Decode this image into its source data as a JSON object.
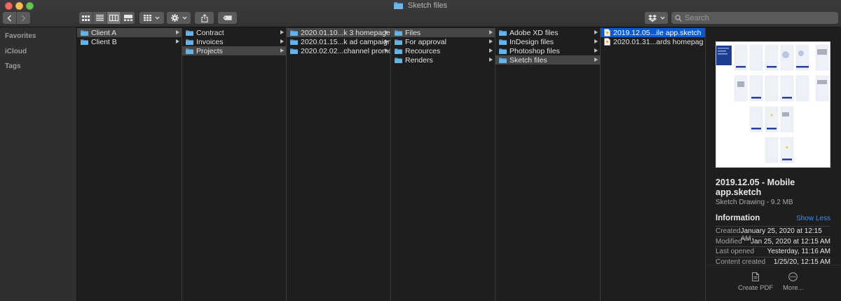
{
  "window": {
    "title": "Sketch files"
  },
  "search": {
    "placeholder": "Search"
  },
  "sidebar": {
    "sections": [
      "Favorites",
      "iCloud",
      "Tags"
    ]
  },
  "columns": [
    {
      "items": [
        {
          "label": "Client A",
          "type": "folder",
          "state": "path",
          "arrow": true
        },
        {
          "label": "Client B",
          "type": "folder",
          "state": "",
          "arrow": true
        }
      ]
    },
    {
      "items": [
        {
          "label": "Contract",
          "type": "folder",
          "state": "",
          "arrow": true
        },
        {
          "label": "Invoices",
          "type": "folder",
          "state": "",
          "arrow": true
        },
        {
          "label": "Projects",
          "type": "folder",
          "state": "path",
          "arrow": true
        }
      ]
    },
    {
      "items": [
        {
          "label": "2020.01.10...k  3 homepage",
          "type": "folder",
          "state": "path",
          "arrow": true
        },
        {
          "label": "2020.01.15...k ad campaign",
          "type": "folder",
          "state": "",
          "arrow": true
        },
        {
          "label": "2020.02.02...channel promo",
          "type": "folder",
          "state": "",
          "arrow": true
        }
      ]
    },
    {
      "items": [
        {
          "label": "Files",
          "type": "folder",
          "state": "path",
          "arrow": true
        },
        {
          "label": "For approval",
          "type": "folder",
          "state": "",
          "arrow": true
        },
        {
          "label": "Recources",
          "type": "folder",
          "state": "",
          "arrow": true
        },
        {
          "label": "Renders",
          "type": "folder",
          "state": "",
          "arrow": true
        }
      ]
    },
    {
      "items": [
        {
          "label": "Adobe XD files",
          "type": "folder",
          "state": "",
          "arrow": true
        },
        {
          "label": "InDesign files",
          "type": "folder",
          "state": "",
          "arrow": true
        },
        {
          "label": "Photoshop files",
          "type": "folder",
          "state": "",
          "arrow": true
        },
        {
          "label": "Sketch files",
          "type": "folder",
          "state": "path",
          "arrow": true
        }
      ]
    },
    {
      "items": [
        {
          "label": "2019.12.05...ile app.sketch",
          "type": "file",
          "state": "selected",
          "arrow": false
        },
        {
          "label": "2020.01.31...ards homepag",
          "type": "file",
          "state": "",
          "arrow": false
        }
      ]
    }
  ],
  "preview": {
    "name": "2019.12.05 - Mobile app.sketch",
    "kind": "Sketch Drawing - 9.2 MB",
    "info_title": "Information",
    "show_less": "Show Less",
    "info": [
      {
        "key": "Created",
        "value": "January 25, 2020 at 12:15 AM"
      },
      {
        "key": "Modified",
        "value": "Jan 25, 2020 at 12:15 AM"
      },
      {
        "key": "Last opened",
        "value": "Yesterday, 11:16 AM"
      },
      {
        "key": "Content created",
        "value": "1/25/20, 12:15 AM"
      }
    ],
    "actions": [
      {
        "label": "Create PDF",
        "icon": "pdf-document-icon"
      },
      {
        "label": "More...",
        "icon": "more-ellipsis-icon"
      }
    ]
  },
  "colors": {
    "selection": "#0a5bd3",
    "path_highlight": "#464646",
    "folder_blue": "#5aa8e0",
    "link": "#3a8df5"
  }
}
